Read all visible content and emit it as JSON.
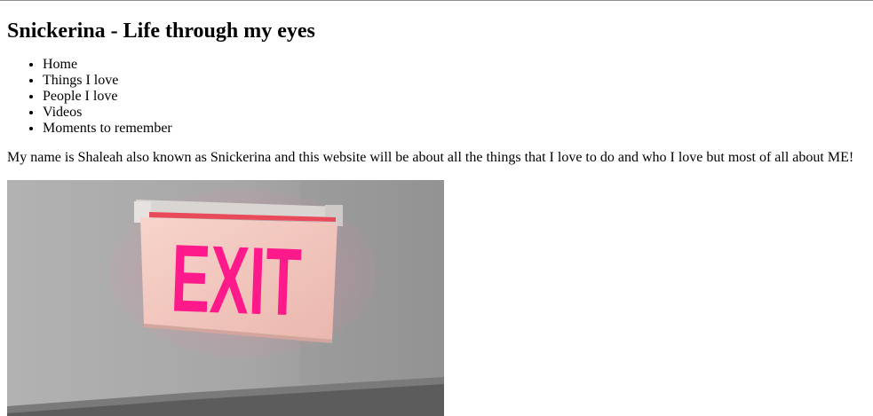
{
  "page": {
    "heading": "Snickerina - Life through my eyes",
    "intro": "My name is Shaleah also known as Snickerina and this website will be about all the things that I love to do and who I love but most of all about ME!"
  },
  "nav": {
    "items": [
      {
        "label": "Home"
      },
      {
        "label": "Things I love"
      },
      {
        "label": "People I love"
      },
      {
        "label": "Videos"
      },
      {
        "label": "Moments to remember"
      }
    ]
  },
  "photo": {
    "sign_text": "EXIT",
    "colors": {
      "wall": "#a9a9a9",
      "sign_panel": "#f4c9c0",
      "sign_letters": "#ff1a8c",
      "ceiling_trim": "#5c5c5c"
    }
  }
}
